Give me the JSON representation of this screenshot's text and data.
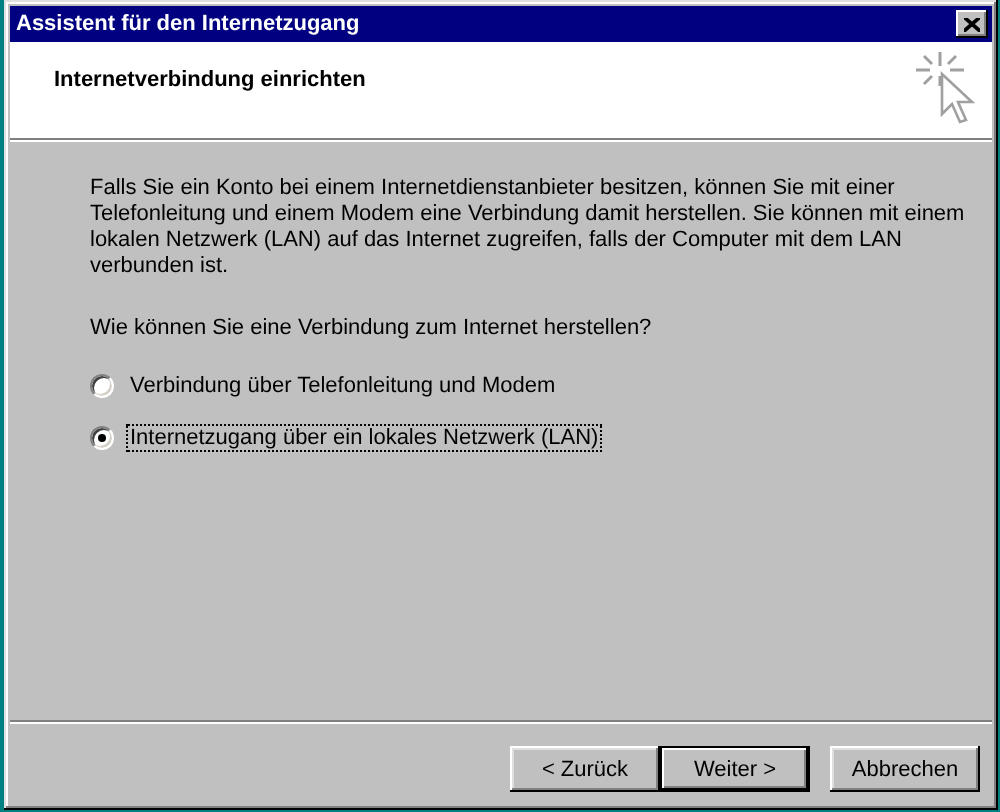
{
  "window": {
    "title": "Assistent für den Internetzugang"
  },
  "header": {
    "title": "Internetverbindung einrichten"
  },
  "intro": "Falls Sie ein Konto bei einem Internetdienstanbieter besitzen, können Sie mit einer Telefonleitung und einem Modem eine Verbindung damit herstellen. Sie können mit einem lokalen Netzwerk (LAN) auf das Internet zugreifen, falls der Computer mit dem LAN verbunden ist.",
  "question": "Wie können Sie eine Verbindung zum Internet herstellen?",
  "options": [
    {
      "label": "Verbindung über Telefonleitung und Modem",
      "selected": false
    },
    {
      "label": "Internetzugang über ein lokales Netzwerk (LAN)",
      "selected": true
    }
  ],
  "buttons": [
    {
      "label": "< Zurück",
      "default": false
    },
    {
      "label": "Weiter >",
      "default": true
    },
    {
      "label": "Abbrechen",
      "default": false
    }
  ]
}
